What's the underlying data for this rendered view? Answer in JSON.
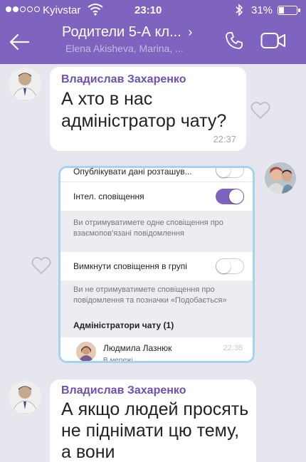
{
  "status_bar": {
    "carrier": "Kyivstar",
    "time": "23:10",
    "battery": "31%",
    "battery_level": 0.31,
    "signal_strength": 2
  },
  "header": {
    "title": "Родители 5-А кл...",
    "chevron": "›",
    "subtitle": "Elena Akisheva, Marina, ...",
    "back_icon": "back-arrow-icon",
    "call_icon": "phone-icon",
    "video_icon": "video-camera-icon",
    "color": "#7e63bf"
  },
  "messages": [
    {
      "sender": "Владислав Захаренко",
      "text": "А хто в нас адміністратор чату?",
      "time": "22:37"
    },
    {
      "sender": "Владислав Захаренко",
      "text": "А якщо людей просять не піднімати цю тему, а вони"
    }
  ],
  "screenshot": {
    "location_label": "Опублікувати дані розташув...",
    "smart_label": "Інтел. сповіщення",
    "smart_on": true,
    "smart_note": "Ви отримуватимете одне сповіщення про взаємопов'язані повідомлення",
    "mute_label": "Вимкнути сповіщення в групі",
    "mute_on": false,
    "mute_note": "Ви не отримуватимете сповіщення про повідомлення та позначки «Подобається»",
    "admins_title": "Адміністратори чату (1)",
    "admin_name": "Людмила Лазнюк",
    "admin_status": "В мережі",
    "admin_time": "22:38"
  }
}
